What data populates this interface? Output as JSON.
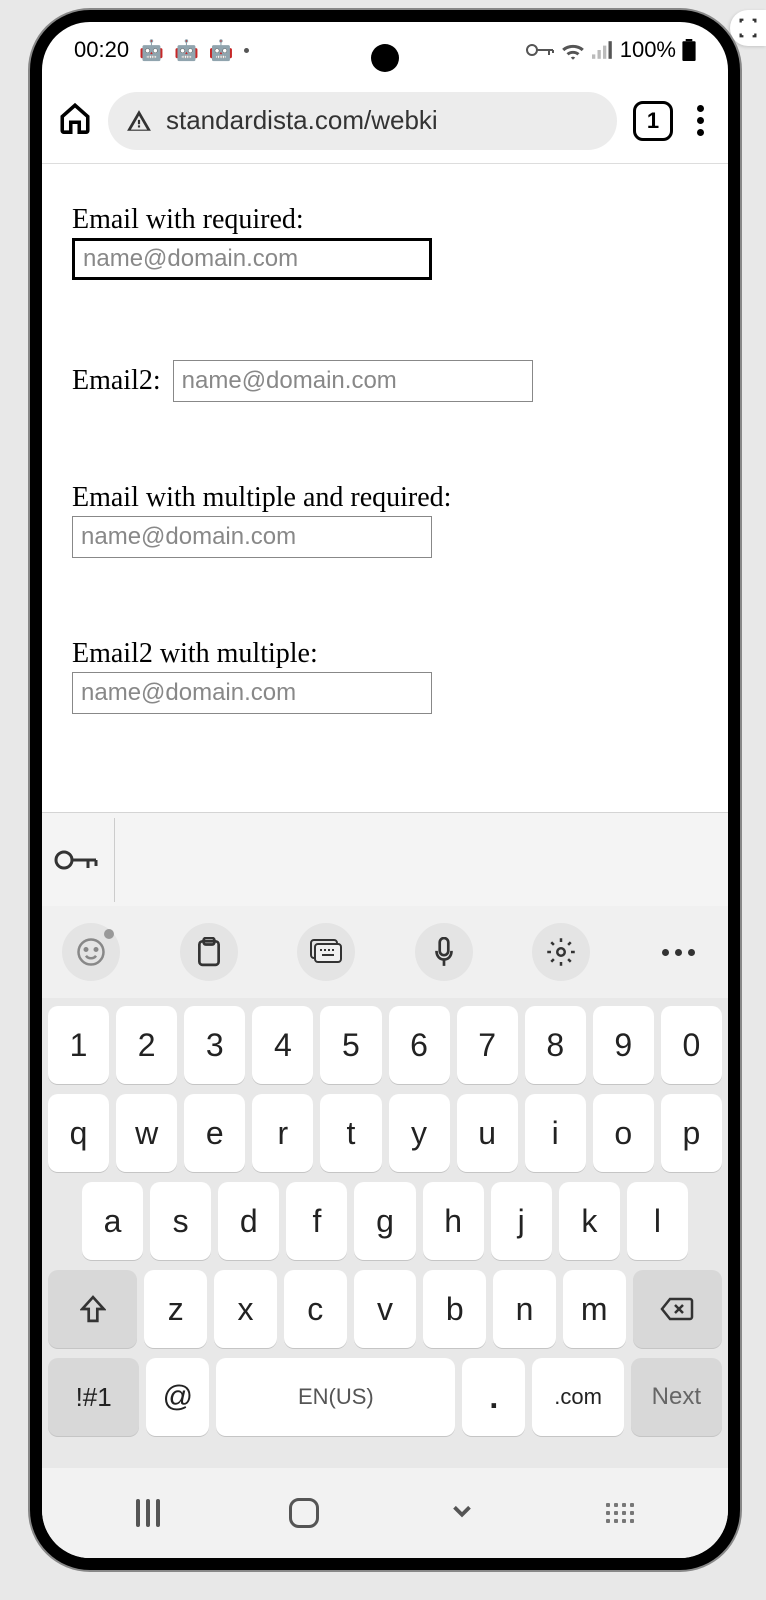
{
  "status": {
    "time": "00:20",
    "battery": "100%"
  },
  "browser": {
    "url": "standardista.com/webki",
    "tab_count": "1"
  },
  "form": {
    "field1_label": "Email with required:",
    "field1_placeholder": "name@domain.com",
    "field2_label": "Email2:",
    "field2_placeholder": "name@domain.com",
    "field3_label": "Email with multiple and required:",
    "field3_placeholder": "name@domain.com",
    "field4_label": "Email2 with multiple:",
    "field4_placeholder": "name@domain.com"
  },
  "keyboard": {
    "row_num": [
      "1",
      "2",
      "3",
      "4",
      "5",
      "6",
      "7",
      "8",
      "9",
      "0"
    ],
    "row1": [
      "q",
      "w",
      "e",
      "r",
      "t",
      "y",
      "u",
      "i",
      "o",
      "p"
    ],
    "row2": [
      "a",
      "s",
      "d",
      "f",
      "g",
      "h",
      "j",
      "k",
      "l"
    ],
    "row3": [
      "z",
      "x",
      "c",
      "v",
      "b",
      "n",
      "m"
    ],
    "sym_key": "!#1",
    "at_key": "@",
    "space_label": "EN(US)",
    "period_key": ".",
    "com_key": ".com",
    "next_key": "Next"
  }
}
